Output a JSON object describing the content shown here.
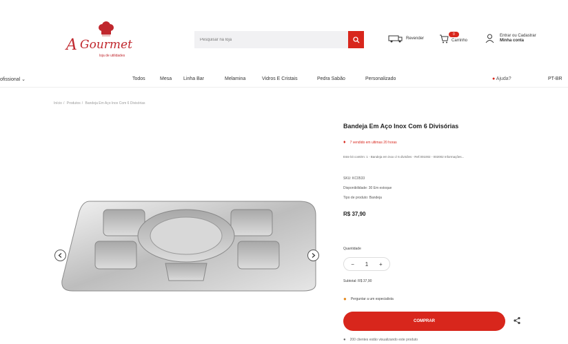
{
  "header": {
    "logo_text": "A Gourmet",
    "logo_subtext": "loja de utilidades",
    "search_placeholder": "Pesquisar na loja",
    "revenue_label": "Revender",
    "cart": {
      "label": "Carrinho",
      "count": "0"
    },
    "account": {
      "line1": "Entrar ou Cadastrar",
      "line2": "Minha conta"
    }
  },
  "nav": {
    "left_label": "ofissional",
    "items": [
      "Todos",
      "Mesa",
      "Linha Bar",
      "Melamina",
      "Vidros E Cristais",
      "Pedra Sabão",
      "Personalizado"
    ],
    "help": "Ajuda?",
    "extra": "PT-BR"
  },
  "breadcrumb": [
    "Início",
    "Produtos",
    "Bandeja Em Aço Inox Com 6 Divisórias"
  ],
  "product": {
    "title": "Bandeja Em Aço Inox Com 6 Divisórias",
    "hot": "7 vendido em ultimas 20 horas",
    "description": "Este kit contém: 1 - Bandeja em inox c/ 6 divisões - Ref.001002 - 002002 Informações...",
    "sku": "SKU: KC0533",
    "availability": "Disponibilidade: 30 Em estoque",
    "type": "Tipo de produto: Bandeja",
    "price": "R$ 37,90",
    "quantity_label": "Quantidade",
    "quantity": "1",
    "subtotal": "Subtotal: R$ 37,90",
    "specialist": "Perguntar a um especialista",
    "buy_label": "COMPRAR",
    "footnote": "200 clientes estão visualizando este produto"
  },
  "colors": {
    "accent": "#d8261c"
  }
}
